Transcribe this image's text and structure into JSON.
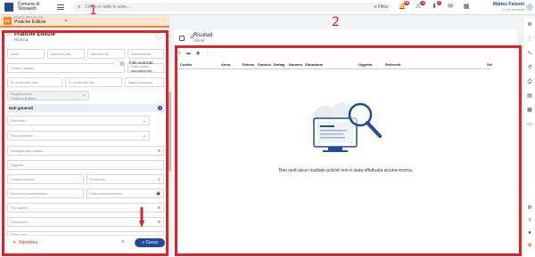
{
  "topbar": {
    "town_line1": "Comune di",
    "town_line2": "Sloraweb",
    "search_placeholder": "Cerca in tutte le aree...",
    "filter_label": "Filtra",
    "icons": [
      {
        "name": "bell-icon",
        "glyph": "🔔",
        "badge": "56"
      },
      {
        "name": "alert-icon",
        "glyph": "⚠",
        "badge": "12"
      },
      {
        "name": "download-icon",
        "glyph": "⬇",
        "badge": "2"
      },
      {
        "name": "mail-icon",
        "glyph": "✉",
        "badge": ""
      },
      {
        "name": "apps-icon",
        "glyph": "▦",
        "badge": ""
      }
    ],
    "user_name": "Matteo Falsetti",
    "user_sub": "Il tuo account"
  },
  "tab": {
    "icon_text": "PE",
    "small": "PRATICHE EDILIZIE",
    "title": "Pratiche Edilizie",
    "close": "✕"
  },
  "left": {
    "title": "Pratiche Edilizie",
    "subtitle": "Ricerca",
    "fields": {
      "anno": "Anno",
      "numero_da": "Numero (da)",
      "numero_a": "Numero (a)",
      "annotazione": "Annotazione",
      "codice_pratica": "Codice pratica",
      "stato_partic_label": "Stato partic...",
      "stato_partic_value": "giornalmente ...",
      "n_protocollo_da": "N. protocollo (da)",
      "n_protocollo_a": "N. protocollo (a)",
      "data_protocollo": "Data protocollo",
      "registrazione_label": "Registrazione",
      "registrazione_value": "Pratiche Edilizie"
    },
    "toggle_label": "Filtri avanzati",
    "section_title": "Dati generali",
    "generali": {
      "macrotipo": "Macrotipo",
      "procedimento": "Procedimento",
      "dettaglio_tipo": "Dettaglio tipo pratica",
      "oggetto": "Oggetto",
      "codice_istanza": "Codice istanza",
      "fascicolo": "Fascicolo",
      "numero_provv": "Numero provvedimento",
      "data_provv": "Data provvedimento",
      "tipo_opera": "Tipo opera",
      "situazione": "Situazione",
      "protocollo": "Protocollo",
      "unknown_row": "..."
    },
    "reset_label": "Ripristina",
    "search_button": "Cerca"
  },
  "right": {
    "title": "Risultati",
    "subtitle": "Azioni",
    "columns": [
      "Codice",
      "Anno",
      "Esteso",
      "Fascico",
      "Dettag",
      "Numero",
      "Situazione",
      "Oggetto",
      "Referenti",
      "Sel"
    ],
    "empty_message": "Non vedi alcun risultato poiché non è stata effettuata alcuna ricerca."
  },
  "annotations": {
    "label1": "1",
    "label2": "2"
  },
  "colors": {
    "brand": "#1e4c9a",
    "tab_orange": "#f58220",
    "annotation_red": "#e0202a"
  }
}
